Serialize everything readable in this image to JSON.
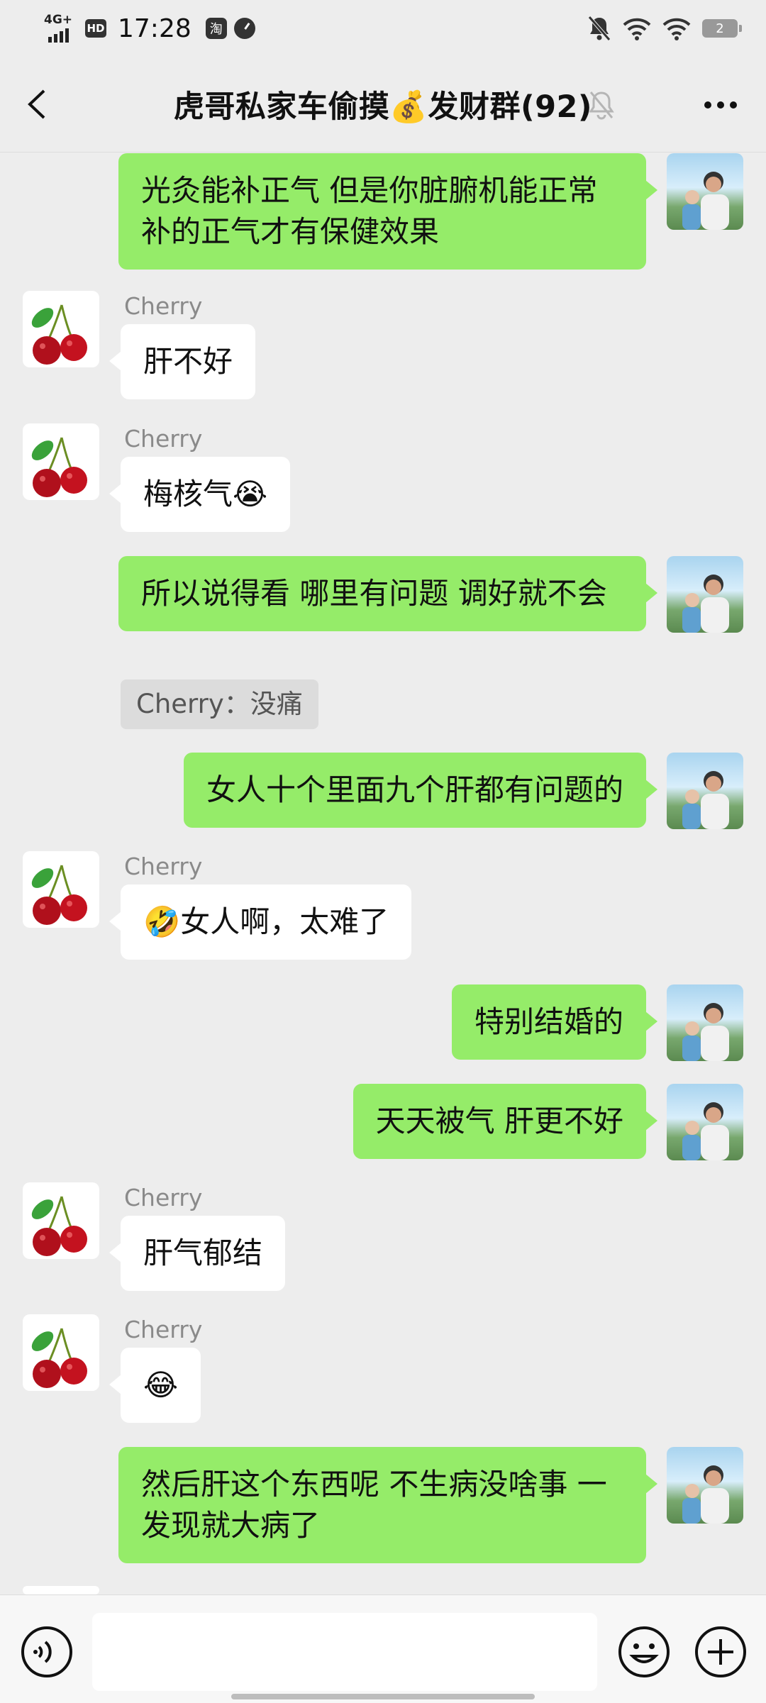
{
  "status_bar": {
    "network": "4G+",
    "hd": "HD",
    "time": "17:28",
    "app_icon_glyph": "淘",
    "battery": "2"
  },
  "header": {
    "title": "虎哥私家车偷摸💰发财群(92)"
  },
  "colors": {
    "background": "#ededed",
    "outgoing_bubble": "#95ec69",
    "incoming_bubble": "#ffffff",
    "sender_name": "#8a8a8a"
  },
  "messages": [
    {
      "direction": "out",
      "text": "光灸能补正气 但是你脏腑机能正常补的正气才有保健效果"
    },
    {
      "direction": "in",
      "sender": "Cherry",
      "text": "肝不好"
    },
    {
      "direction": "in",
      "sender": "Cherry",
      "text": "梅核气😭"
    },
    {
      "direction": "out",
      "text": "所以说得看 哪里有问题 调好就不会"
    },
    {
      "direction": "quote",
      "text": "Cherry：没痛"
    },
    {
      "direction": "out",
      "text": "女人十个里面九个肝都有问题的"
    },
    {
      "direction": "in",
      "sender": "Cherry",
      "text": "🤣女人啊，太难了"
    },
    {
      "direction": "out",
      "text": "特别结婚的"
    },
    {
      "direction": "out",
      "text": "天天被气 肝更不好"
    },
    {
      "direction": "in",
      "sender": "Cherry",
      "text": "肝气郁结"
    },
    {
      "direction": "in",
      "sender": "Cherry",
      "text": "😂"
    },
    {
      "direction": "out",
      "text": "然后肝这个东西呢 不生病没啥事 一发现就大病了"
    }
  ],
  "input_bar": {
    "placeholder": "",
    "icons": [
      "voice-icon",
      "emoji-icon",
      "plus-icon"
    ]
  }
}
